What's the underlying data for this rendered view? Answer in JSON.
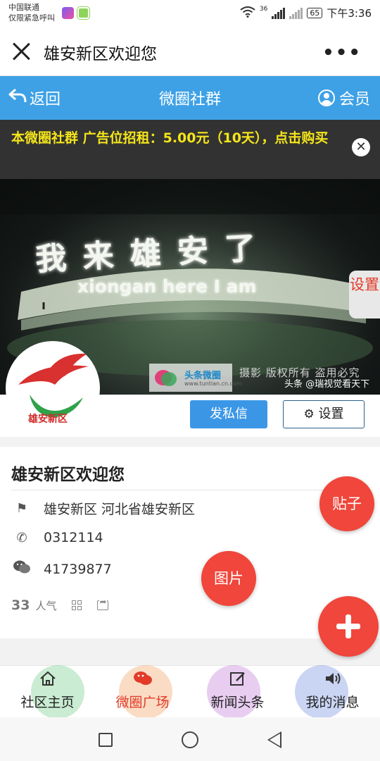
{
  "status_bar": {
    "carrier": "中国联通",
    "emergency": "仅限紧急呼叫",
    "network": "36",
    "battery": "65",
    "time": "下午3:36"
  },
  "window": {
    "title": "雄安新区欢迎您",
    "more": "•••"
  },
  "nav": {
    "back_label": "返回",
    "title": "微圈社群",
    "member_label": "会员"
  },
  "ad_banner": {
    "text": "本微圈社群 广告位招租：5.00元（10天），点击购买",
    "close": "✕"
  },
  "cover": {
    "headline": "我 来 雄 安 了",
    "subline": "xiongan here  I am",
    "setting_tab": "设置",
    "watermark_brand": "头条微圈",
    "watermark_url": "www.tuntian.cn.com",
    "watermark_text": "摄影 版权所有 盗用必究",
    "credit": "头条 @瑞视觉看天下"
  },
  "profile": {
    "logo_name": "雄安新区",
    "message_button": "发私信",
    "settings_button": "设置"
  },
  "info": {
    "title": "雄安新区欢迎您",
    "address": "雄安新区 河北省雄安新区",
    "phone": "0312114",
    "wechat": "41739877",
    "popularity_count": "33",
    "popularity_label": "人气"
  },
  "fabs": {
    "post": "贴子",
    "image": "图片"
  },
  "tabs": [
    {
      "label": "社区主页",
      "color": "#9fdcb0"
    },
    {
      "label": "微圈广场",
      "color": "#f6b98a"
    },
    {
      "label": "新闻头条",
      "color": "#d79de8"
    },
    {
      "label": "我的消息",
      "color": "#a9b8ee"
    }
  ],
  "colors": {
    "nav_blue": "#3ea1e6",
    "ad_yellow": "#f5e51a",
    "fab_red": "#f0463b",
    "active_tab": "#e23b2a"
  }
}
